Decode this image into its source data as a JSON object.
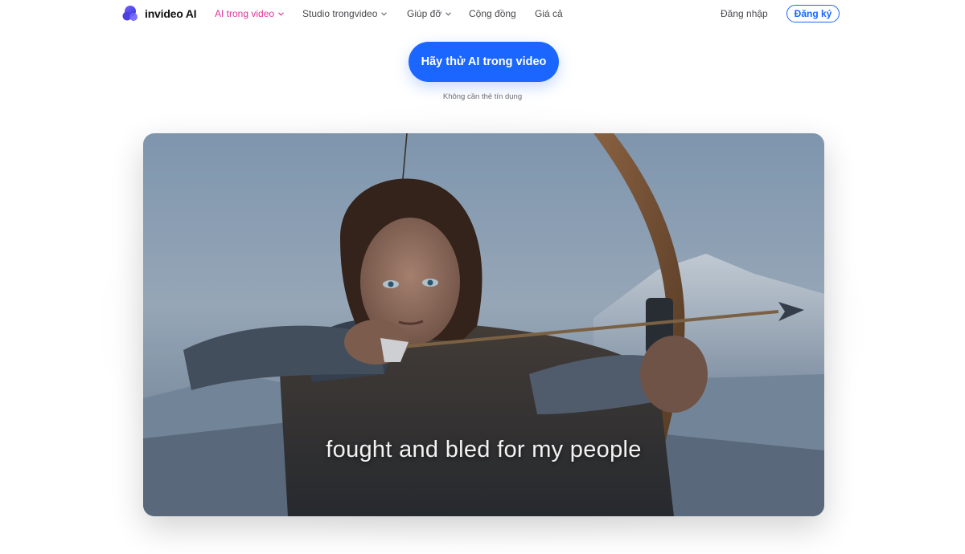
{
  "brand": {
    "name": "invideo AI",
    "logo_icon": "invideo-logo-icon"
  },
  "nav": {
    "items": [
      {
        "label": "AI trong video",
        "active": true,
        "has_dropdown": true
      },
      {
        "label": "Studio trongvideo",
        "active": false,
        "has_dropdown": true
      },
      {
        "label": "Giúp đỡ",
        "active": false,
        "has_dropdown": true
      },
      {
        "label": "Cộng đồng",
        "active": false,
        "has_dropdown": false
      },
      {
        "label": "Giá cả",
        "active": false,
        "has_dropdown": false
      }
    ],
    "login_label": "Đăng nhập",
    "signup_label": "Đăng ký"
  },
  "hero": {
    "cta_label": "Hãy thử AI trong video",
    "cta_note": "Không cần thẻ tín dụng"
  },
  "video": {
    "caption": "fought and bled for my people"
  },
  "colors": {
    "accent_blue": "#1a66ff",
    "active_pink": "#e0349a"
  }
}
